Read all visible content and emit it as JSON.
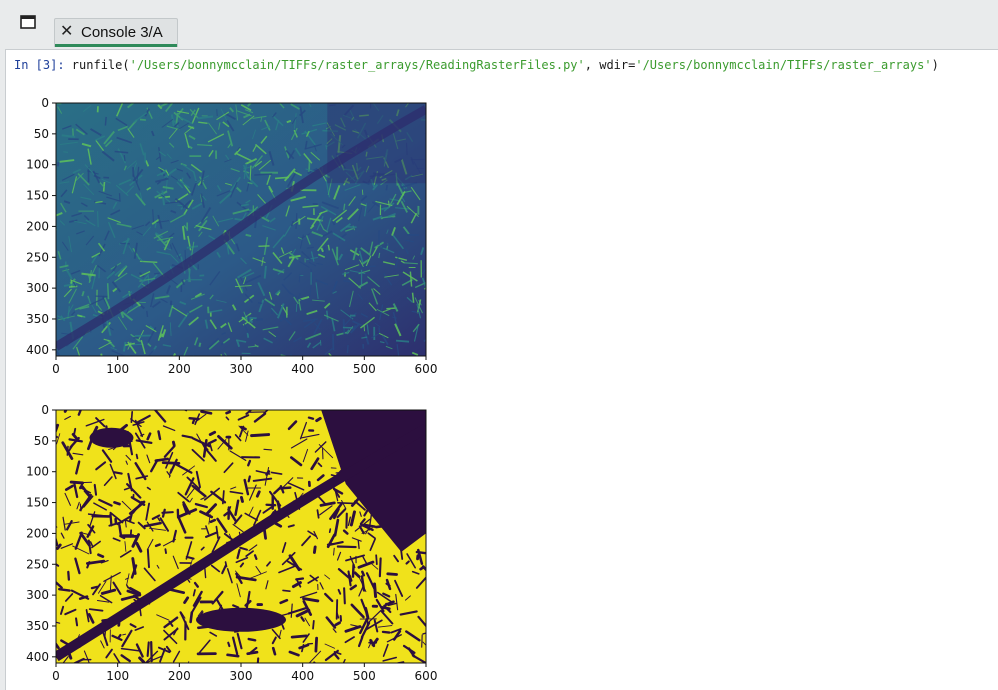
{
  "tab": {
    "close_glyph": "✕",
    "label": "Console 3/A",
    "accent": "#2f8a5a"
  },
  "console": {
    "prompt": "In [3]:",
    "call_prefix": " runfile(",
    "file_arg": "'/Users/bonnymcclain/TIFFs/raster_arrays/ReadingRasterFiles.py'",
    "sep": ", wdir=",
    "wdir_arg": "'/Users/bonnymcclain/TIFFs/raster_arrays'",
    "call_suffix": ")"
  },
  "chart_data": [
    {
      "type": "heatmap",
      "colormap": "viridis",
      "xlim": [
        0,
        600
      ],
      "ylim": [
        410,
        0
      ],
      "xticks": [
        0,
        100,
        200,
        300,
        400,
        500,
        600
      ],
      "yticks": [
        0,
        50,
        100,
        150,
        200,
        250,
        300,
        350,
        400
      ],
      "colors": {
        "low": "#2d2f6e",
        "mid": "#2a7d86",
        "high": "#5ec25a"
      }
    },
    {
      "type": "heatmap",
      "colormap": "binary viridis",
      "xlim": [
        0,
        600
      ],
      "ylim": [
        410,
        0
      ],
      "xticks": [
        0,
        100,
        200,
        300,
        400,
        500,
        600
      ],
      "yticks": [
        0,
        50,
        100,
        150,
        200,
        250,
        300,
        350,
        400
      ],
      "colors": {
        "low": "#2c0f3f",
        "high": "#f0e21b"
      }
    }
  ]
}
